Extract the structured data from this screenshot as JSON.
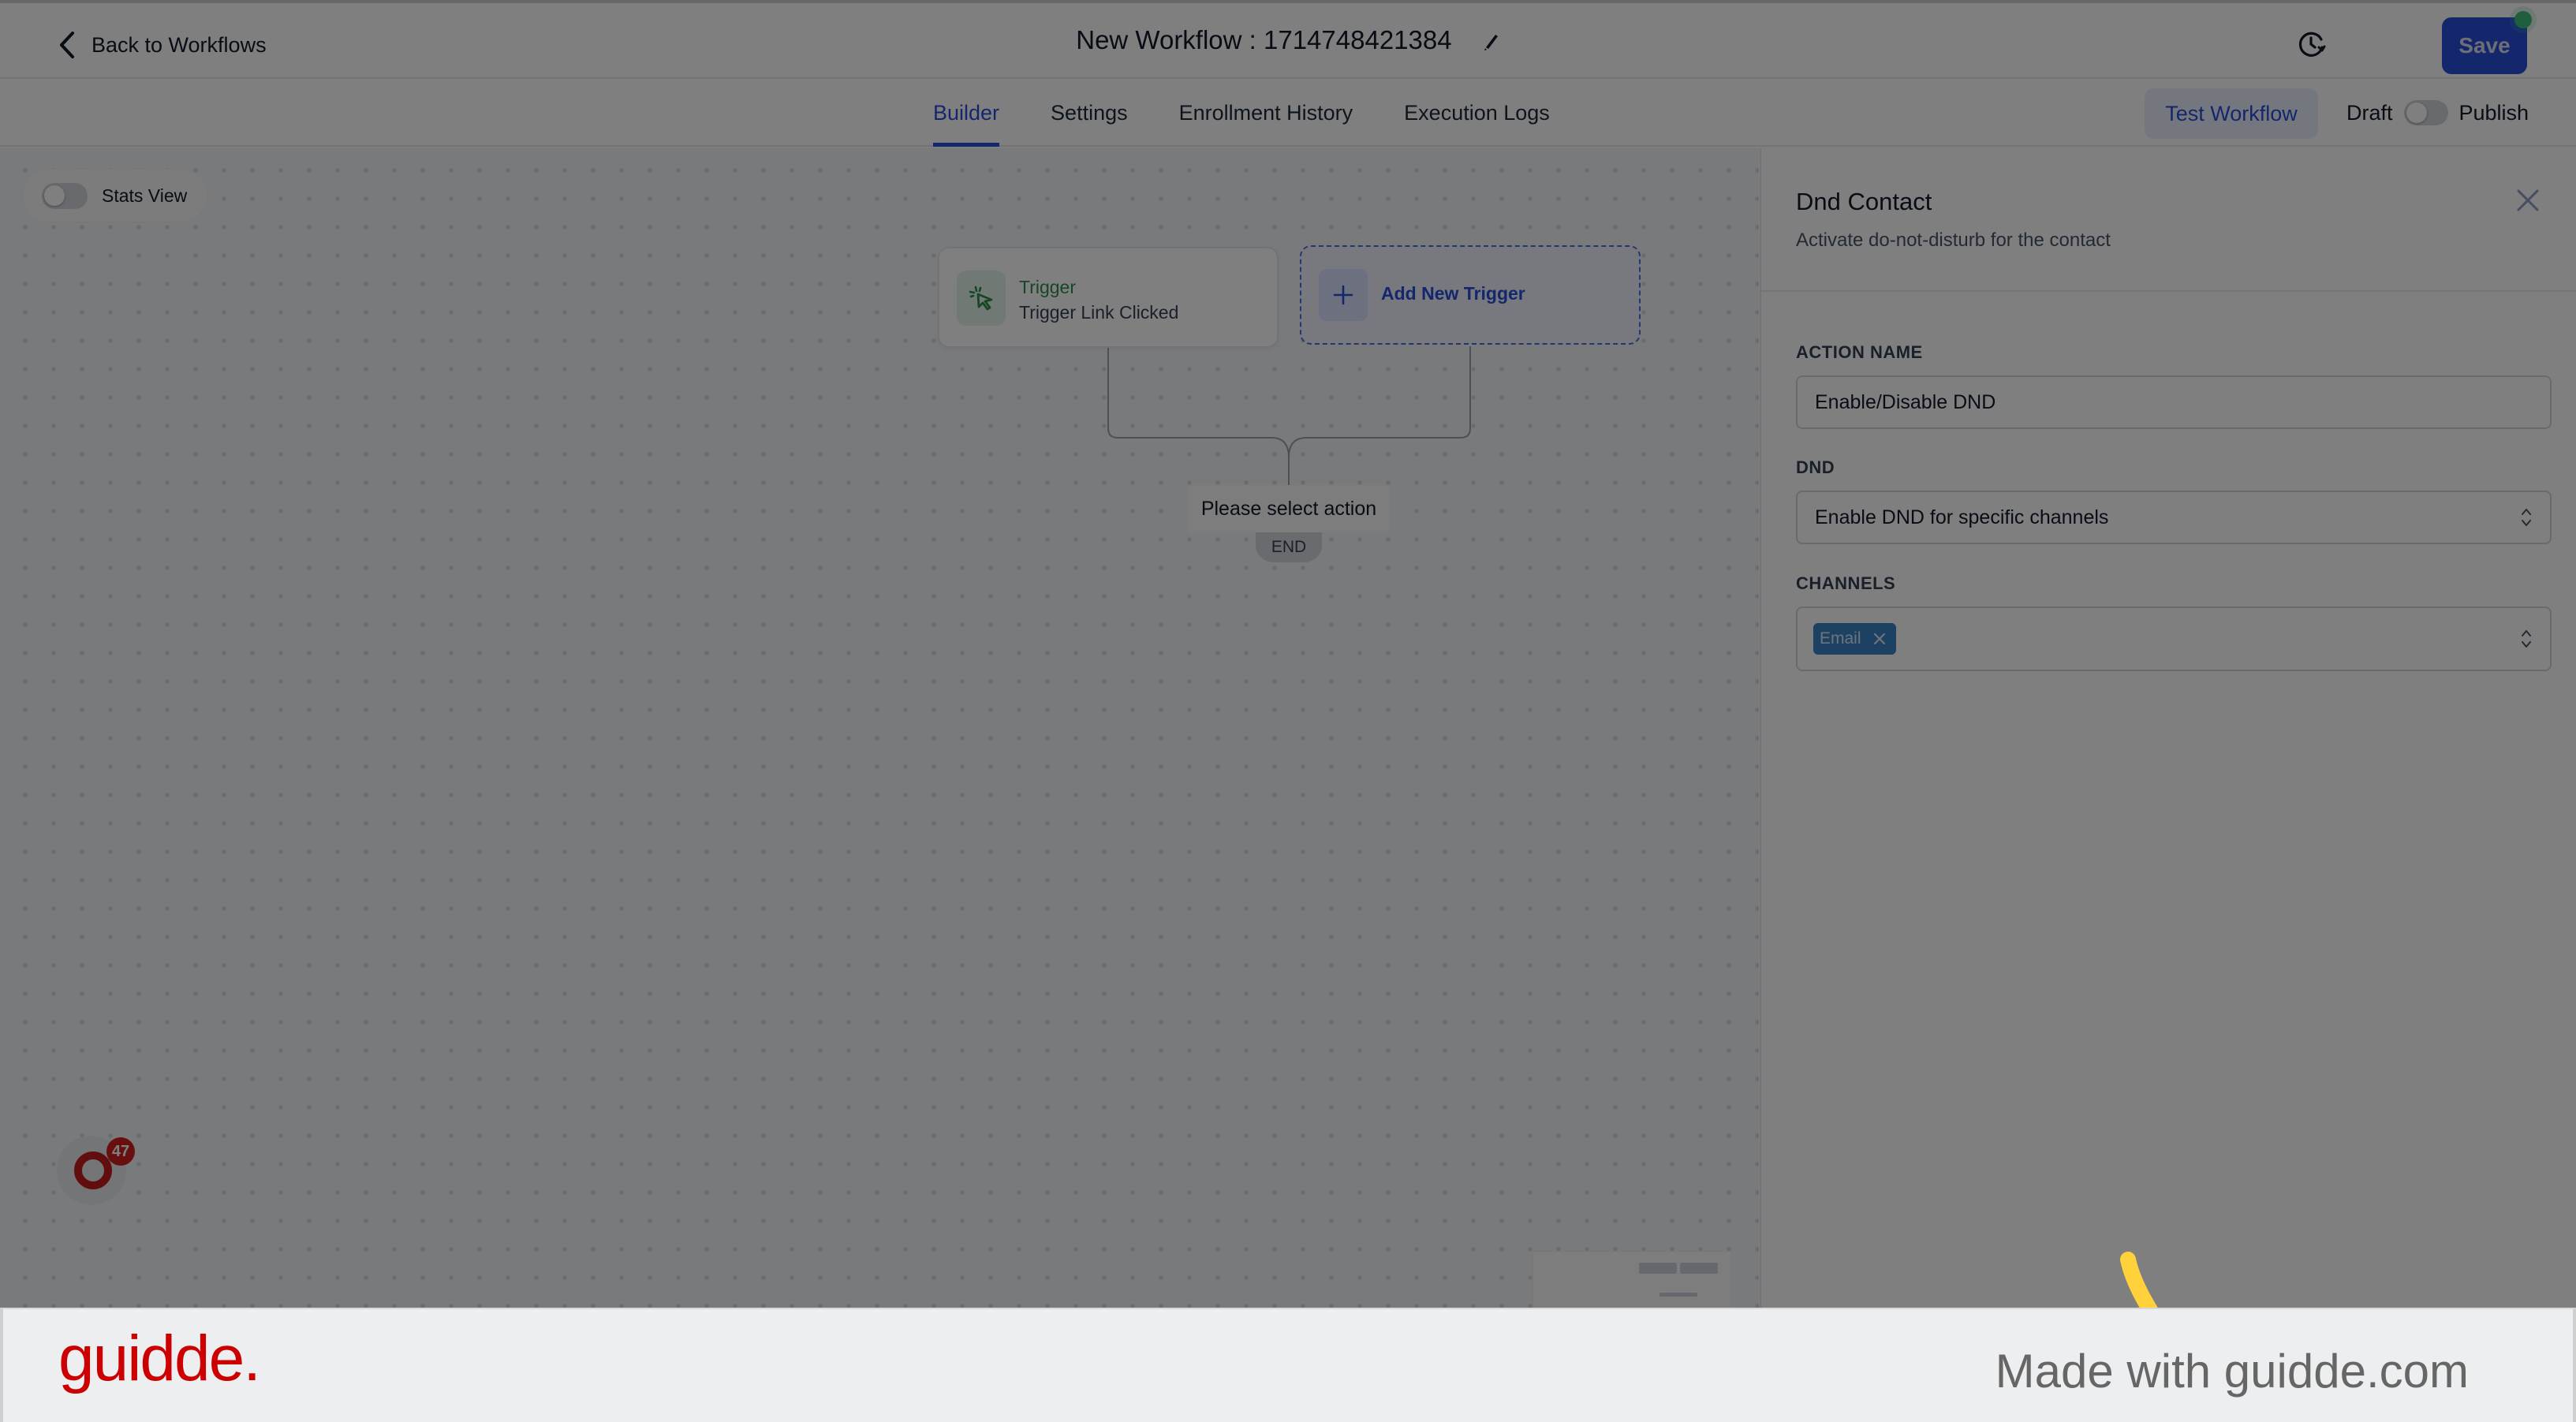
{
  "header": {
    "back_label": "Back to Workflows",
    "workflow_title": "New Workflow : 1714748421384",
    "save_label": "Save",
    "save_status": "unsaved-changes-dot",
    "icons": {
      "back": "chevron-left-icon",
      "edit": "pencil-icon",
      "history": "history-clock-icon"
    }
  },
  "tabs": [
    {
      "label": "Builder",
      "active": true
    },
    {
      "label": "Settings",
      "active": false
    },
    {
      "label": "Enrollment History",
      "active": false
    },
    {
      "label": "Execution Logs",
      "active": false
    }
  ],
  "tabbar_actions": {
    "test_label": "Test Workflow",
    "draft_label": "Draft",
    "publish_label": "Publish",
    "publish_toggle_on": false
  },
  "canvas": {
    "stats_view_label": "Stats View",
    "stats_view_on": false,
    "trigger_node": {
      "type_label": "Trigger",
      "name": "Trigger Link Clicked",
      "icon": "cursor-click-icon"
    },
    "add_trigger_label": "Add New Trigger",
    "action_placeholder": "Please select action",
    "end_label": "END",
    "help_badge_count": "47"
  },
  "panel": {
    "title": "Dnd Contact",
    "subtitle": "Activate do-not-disturb for the contact",
    "fields": {
      "action_name": {
        "label": "ACTION NAME",
        "value": "Enable/Disable DND"
      },
      "dnd": {
        "label": "DND",
        "value": "Enable DND for specific channels"
      },
      "channels": {
        "label": "CHANNELS",
        "selected": [
          "Email"
        ]
      }
    }
  },
  "footer": {
    "brand": "guidde.",
    "made_with": "Made with guidde.com"
  },
  "colors": {
    "accent": "#2a4fd8",
    "trigger_green": "#2f8c4f",
    "chip_blue": "#3b82c4",
    "brand_red": "#cc0000",
    "overlay": "rgba(0,0,0,0.5)",
    "cursor_yellow": "#ffd23c"
  }
}
